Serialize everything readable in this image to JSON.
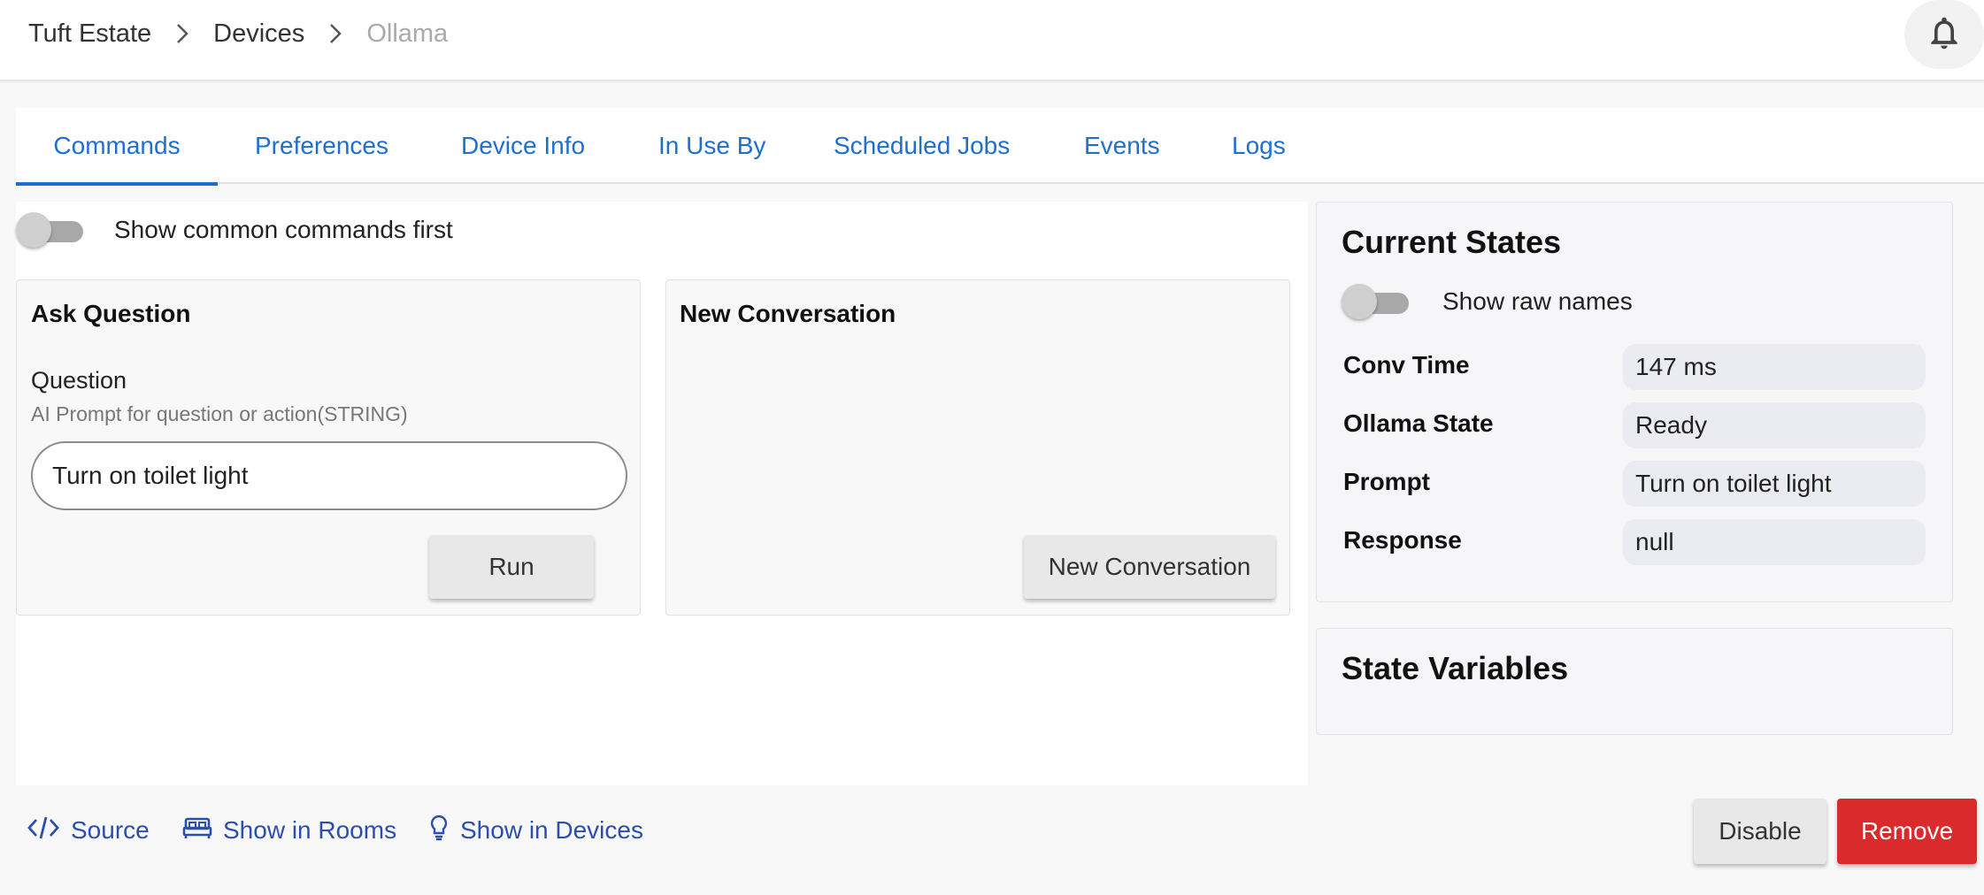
{
  "colors": {
    "accent": "#1f6fd1",
    "link": "#2a4fb0",
    "danger": "#d92b2b"
  },
  "breadcrumb": {
    "items": [
      "Tuft Estate",
      "Devices",
      "Ollama"
    ],
    "separator_icon": "chevron-right-icon"
  },
  "header": {
    "notification_icon": "bell-icon"
  },
  "tabs": [
    {
      "label": "Commands",
      "active": true
    },
    {
      "label": "Preferences"
    },
    {
      "label": "Device Info"
    },
    {
      "label": "In Use By"
    },
    {
      "label": "Scheduled Jobs"
    },
    {
      "label": "Events"
    },
    {
      "label": "Logs"
    }
  ],
  "commands": {
    "common_toggle_label": "Show common commands first",
    "ask_question": {
      "title": "Ask Question",
      "field_label": "Question",
      "field_hint": "AI Prompt for question or action(STRING)",
      "value": "Turn on toilet light",
      "run_label": "Run"
    },
    "new_conversation": {
      "title": "New Conversation",
      "button_label": "New Conversation"
    }
  },
  "current_states": {
    "title": "Current States",
    "raw_toggle_label": "Show raw names",
    "rows": [
      {
        "name": "Conv Time",
        "value": "147 ms"
      },
      {
        "name": "Ollama State",
        "value": "Ready"
      },
      {
        "name": "Prompt",
        "value": "Turn on toilet light"
      },
      {
        "name": "Response",
        "value": "null"
      }
    ]
  },
  "state_variables": {
    "title": "State Variables"
  },
  "footer": {
    "source_label": "Source",
    "rooms_label": "Show in Rooms",
    "devices_label": "Show in Devices",
    "disable_label": "Disable",
    "remove_label": "Remove"
  }
}
